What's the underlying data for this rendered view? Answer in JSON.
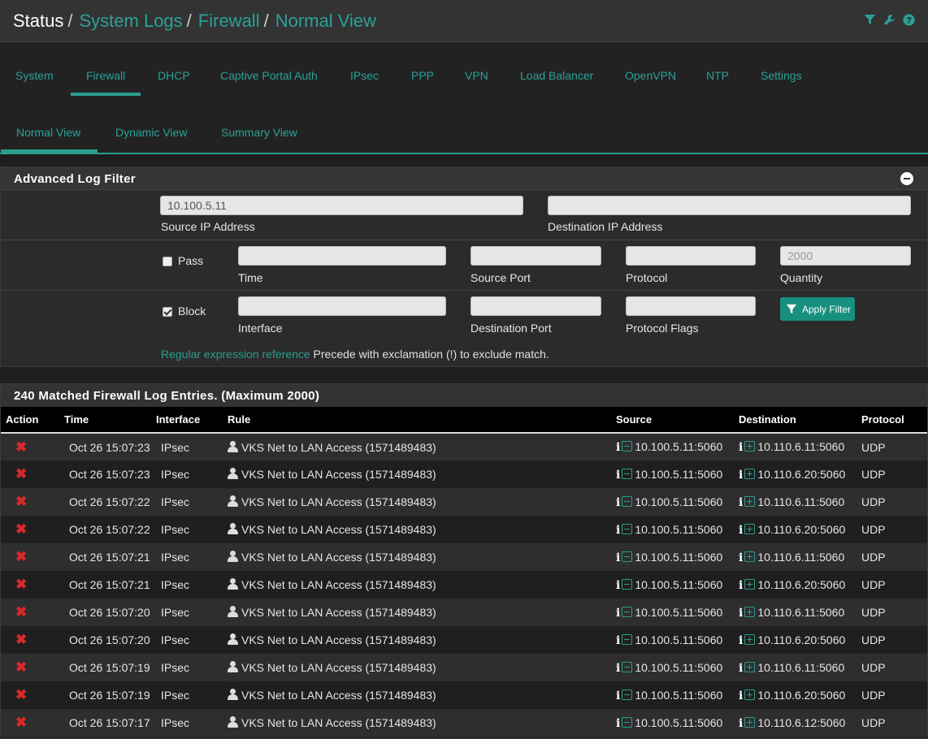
{
  "breadcrumb": {
    "status": "Status",
    "system_logs": "System Logs",
    "firewall": "Firewall",
    "normal_view": "Normal View",
    "sep": "/"
  },
  "header_icons": [
    "filter-icon",
    "wrench-icon",
    "help-icon"
  ],
  "tabs": [
    "System",
    "Firewall",
    "DHCP",
    "Captive Portal Auth",
    "IPsec",
    "PPP",
    "VPN",
    "Load Balancer",
    "OpenVPN",
    "NTP",
    "Settings"
  ],
  "subtabs": [
    "Normal View",
    "Dynamic View",
    "Summary View"
  ],
  "filter": {
    "title": "Advanced Log Filter",
    "source_ip_value": "10.100.5.11",
    "source_ip_label": "Source IP Address",
    "dest_ip_label": "Destination IP Address",
    "pass_label": "Pass",
    "block_label": "Block",
    "time_label": "Time",
    "source_port_label": "Source Port",
    "protocol_label": "Protocol",
    "quantity_label": "Quantity",
    "quantity_placeholder": "2000",
    "interface_label": "Interface",
    "dest_port_label": "Destination Port",
    "protocol_flags_label": "Protocol Flags",
    "apply_label": "Apply Filter",
    "help_link": "Regular expression reference",
    "help_text": " Precede with exclamation (!) to exclude match."
  },
  "results": {
    "title": "240 Matched Firewall Log Entries. (Maximum 2000)",
    "columns": [
      "Action",
      "Time",
      "Interface",
      "Rule",
      "Source",
      "Destination",
      "Protocol"
    ],
    "rows": [
      {
        "time": "Oct 26 15:07:23",
        "iface": "IPsec",
        "rule": "VKS Net to LAN Access (1571489483)",
        "src": "10.100.5.11:5060",
        "dst": "10.110.6.11:5060",
        "proto": "UDP"
      },
      {
        "time": "Oct 26 15:07:23",
        "iface": "IPsec",
        "rule": "VKS Net to LAN Access (1571489483)",
        "src": "10.100.5.11:5060",
        "dst": "10.110.6.20:5060",
        "proto": "UDP"
      },
      {
        "time": "Oct 26 15:07:22",
        "iface": "IPsec",
        "rule": "VKS Net to LAN Access (1571489483)",
        "src": "10.100.5.11:5060",
        "dst": "10.110.6.11:5060",
        "proto": "UDP"
      },
      {
        "time": "Oct 26 15:07:22",
        "iface": "IPsec",
        "rule": "VKS Net to LAN Access (1571489483)",
        "src": "10.100.5.11:5060",
        "dst": "10.110.6.20:5060",
        "proto": "UDP"
      },
      {
        "time": "Oct 26 15:07:21",
        "iface": "IPsec",
        "rule": "VKS Net to LAN Access (1571489483)",
        "src": "10.100.5.11:5060",
        "dst": "10.110.6.11:5060",
        "proto": "UDP"
      },
      {
        "time": "Oct 26 15:07:21",
        "iface": "IPsec",
        "rule": "VKS Net to LAN Access (1571489483)",
        "src": "10.100.5.11:5060",
        "dst": "10.110.6.20:5060",
        "proto": "UDP"
      },
      {
        "time": "Oct 26 15:07:20",
        "iface": "IPsec",
        "rule": "VKS Net to LAN Access (1571489483)",
        "src": "10.100.5.11:5060",
        "dst": "10.110.6.11:5060",
        "proto": "UDP"
      },
      {
        "time": "Oct 26 15:07:20",
        "iface": "IPsec",
        "rule": "VKS Net to LAN Access (1571489483)",
        "src": "10.100.5.11:5060",
        "dst": "10.110.6.20:5060",
        "proto": "UDP"
      },
      {
        "time": "Oct 26 15:07:19",
        "iface": "IPsec",
        "rule": "VKS Net to LAN Access (1571489483)",
        "src": "10.100.5.11:5060",
        "dst": "10.110.6.11:5060",
        "proto": "UDP"
      },
      {
        "time": "Oct 26 15:07:19",
        "iface": "IPsec",
        "rule": "VKS Net to LAN Access (1571489483)",
        "src": "10.100.5.11:5060",
        "dst": "10.110.6.20:5060",
        "proto": "UDP"
      },
      {
        "time": "Oct 26 15:07:17",
        "iface": "IPsec",
        "rule": "VKS Net to LAN Access (1571489483)",
        "src": "10.100.5.11:5060",
        "dst": "10.110.6.12:5060",
        "proto": "UDP"
      }
    ]
  },
  "colors": {
    "accent": "#2a9d8f",
    "block": "#d9292c",
    "apply_button": "#17907f"
  }
}
